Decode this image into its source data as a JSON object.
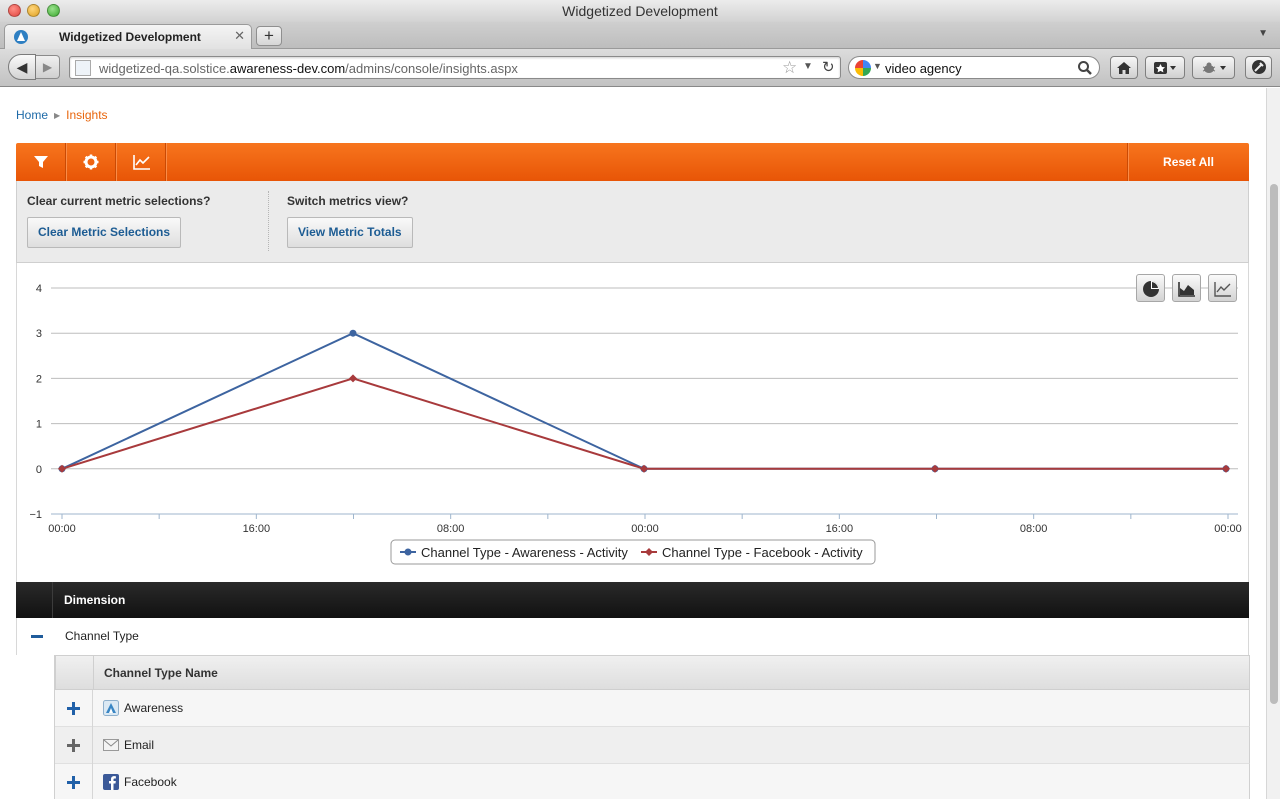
{
  "window": {
    "title": "Widgetized Development"
  },
  "tab": {
    "title": "Widgetized Development",
    "close": "✕",
    "new_tab": "+"
  },
  "navigation": {
    "url_prefix": "widgetized-qa.solstice.",
    "url_domain": "awareness-dev.com",
    "url_path": "/admins/console/insights.aspx",
    "search_value": "video agency"
  },
  "breadcrumb": {
    "home": "Home",
    "current": "Insights"
  },
  "toolbar": {
    "icons": [
      "filter-icon",
      "gear-icon",
      "line-chart-icon"
    ],
    "reset_label": "Reset All",
    "accent_color": "#ee5c0f"
  },
  "options": {
    "clear_question": "Clear current metric selections?",
    "clear_button": "Clear Metric Selections",
    "switch_question": "Switch metrics view?",
    "switch_button": "View Metric Totals"
  },
  "chart_data": {
    "type": "line",
    "title": "",
    "xlabel": "",
    "ylabel": "",
    "ylim": [
      -1,
      4
    ],
    "yticks": [
      "4",
      "3",
      "2",
      "1",
      "0",
      "−1"
    ],
    "xticks": [
      "00:00",
      "16:00",
      "08:00",
      "00:00",
      "16:00",
      "08:00",
      "00:00"
    ],
    "grid": true,
    "legend_position": "bottom-center",
    "chart_type_buttons": [
      "pie-chart-icon",
      "area-chart-icon",
      "line-chart-icon"
    ],
    "series": [
      {
        "name": "Channel Type - Awareness - Activity",
        "color": "#3d64a0",
        "marker": "circle",
        "points": [
          {
            "x_day": 0,
            "y": 0
          },
          {
            "x_day": 1,
            "y": 3
          },
          {
            "x_day": 2,
            "y": 0
          },
          {
            "x_day": 3,
            "y": 0
          },
          {
            "x_day": 4,
            "y": 0
          }
        ]
      },
      {
        "name": "Channel Type - Facebook - Activity",
        "color": "#a83a3c",
        "marker": "diamond",
        "points": [
          {
            "x_day": 0,
            "y": 0
          },
          {
            "x_day": 1,
            "y": 2
          },
          {
            "x_day": 2,
            "y": 0
          },
          {
            "x_day": 3,
            "y": 0
          },
          {
            "x_day": 4,
            "y": 0
          }
        ]
      }
    ]
  },
  "dimensions": {
    "header": "Dimension",
    "group": {
      "label": "Channel Type",
      "column_header": "Channel Type Name",
      "rows": [
        {
          "label": "Awareness",
          "icon": "awareness-icon"
        },
        {
          "label": "Email",
          "icon": "email-icon"
        },
        {
          "label": "Facebook",
          "icon": "facebook-icon"
        }
      ]
    }
  }
}
